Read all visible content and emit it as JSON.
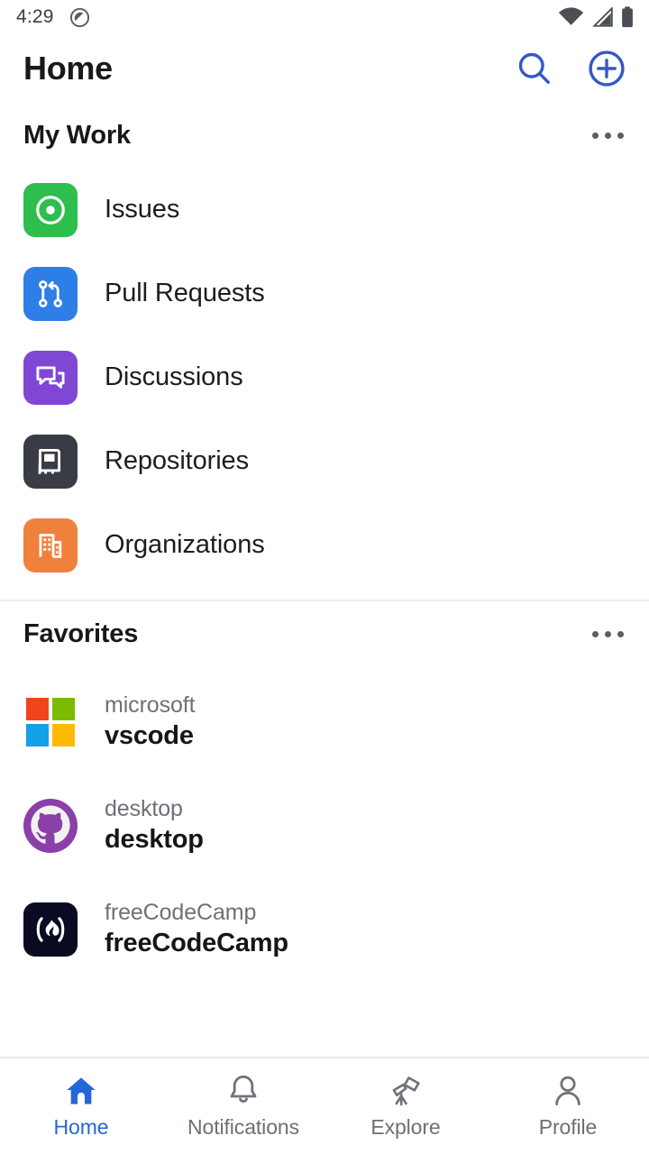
{
  "status_bar": {
    "time": "4:29",
    "left_icon": "do-not-disturb-icon",
    "right_icons": [
      "wifi-icon",
      "cellular-signal-icon",
      "battery-icon"
    ]
  },
  "app_bar": {
    "title": "Home",
    "search_icon": "search-icon",
    "add_icon": "plus-circle-icon"
  },
  "colors": {
    "accent": "#2566d8",
    "issues": "#2DBE4E",
    "pull_requests": "#2E7EE8",
    "discussions": "#7F47D4",
    "repositories": "#3A3C45",
    "organizations": "#F0813C",
    "text_primary": "#17181a",
    "text_secondary": "#6d7177",
    "divider": "#eceef0"
  },
  "my_work": {
    "title": "My Work",
    "overflow_label": "more-options",
    "items": [
      {
        "label": "Issues",
        "icon": "issue-opened-icon",
        "color": "#2DBE4E"
      },
      {
        "label": "Pull Requests",
        "icon": "git-pull-request-icon",
        "color": "#2E7EE8"
      },
      {
        "label": "Discussions",
        "icon": "comment-discussion-icon",
        "color": "#7F47D4"
      },
      {
        "label": "Repositories",
        "icon": "repo-icon",
        "color": "#3A3C45"
      },
      {
        "label": "Organizations",
        "icon": "organization-icon",
        "color": "#F0813C"
      }
    ]
  },
  "favorites": {
    "title": "Favorites",
    "overflow_label": "more-options",
    "items": [
      {
        "owner": "microsoft",
        "name": "vscode",
        "avatar": "microsoft-logo-icon"
      },
      {
        "owner": "desktop",
        "name": "desktop",
        "avatar": "github-octocat-icon"
      },
      {
        "owner": "freeCodeCamp",
        "name": "freeCodeCamp",
        "avatar": "freecodecamp-logo-icon"
      }
    ]
  },
  "bottom_nav": {
    "items": [
      {
        "label": "Home",
        "icon": "home-icon",
        "active": true
      },
      {
        "label": "Notifications",
        "icon": "bell-icon",
        "active": false
      },
      {
        "label": "Explore",
        "icon": "telescope-icon",
        "active": false
      },
      {
        "label": "Profile",
        "icon": "person-icon",
        "active": false
      }
    ]
  }
}
